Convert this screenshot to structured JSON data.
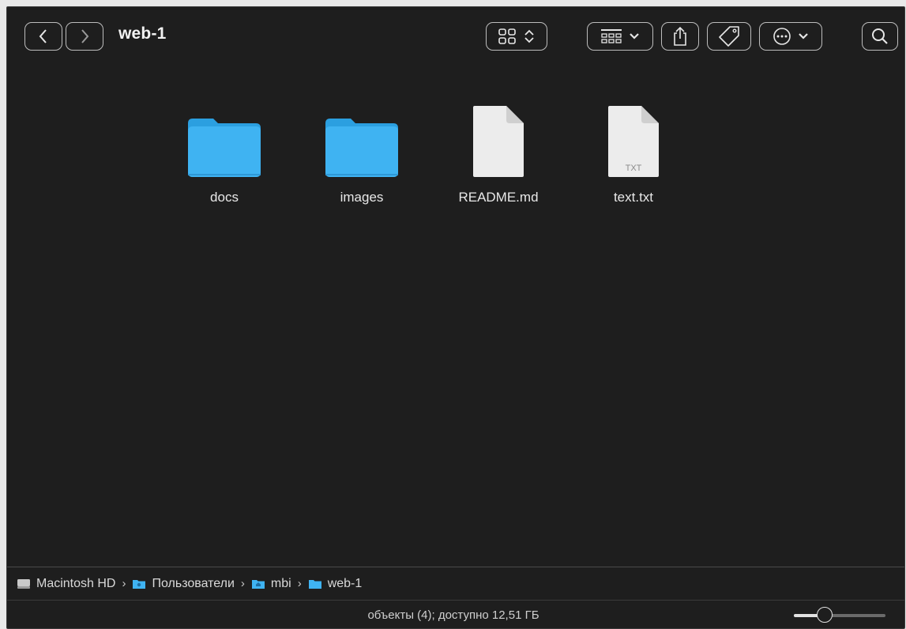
{
  "window": {
    "title": "web-1"
  },
  "toolbar": {
    "back_icon": "chevron-left-icon",
    "forward_icon": "chevron-right-icon",
    "view_icon": "grid-view-icon",
    "group_icon": "group-grid-icon",
    "share_icon": "share-icon",
    "tag_icon": "tag-icon",
    "more_icon": "ellipsis-circle-icon",
    "search_icon": "search-icon"
  },
  "items": [
    {
      "name": "docs",
      "kind": "folder"
    },
    {
      "name": "images",
      "kind": "folder"
    },
    {
      "name": "README.md",
      "kind": "document"
    },
    {
      "name": "text.txt",
      "kind": "document",
      "badge": "TXT"
    }
  ],
  "pathbar": {
    "crumbs": [
      {
        "label": "Macintosh HD",
        "icon": "hard-drive-icon"
      },
      {
        "label": "Пользователи",
        "icon": "users-folder-icon"
      },
      {
        "label": "mbi",
        "icon": "home-folder-icon"
      },
      {
        "label": "web-1",
        "icon": "folder-icon"
      }
    ],
    "separator": "›"
  },
  "status": {
    "text": "объекты (4); доступно 12,51 ГБ",
    "zoom_level": 0.3
  },
  "colors": {
    "folder": "#3fb3f2",
    "folder_tab": "#2b9fe0",
    "document": "#ececec",
    "window_bg": "#1e1e1e"
  }
}
